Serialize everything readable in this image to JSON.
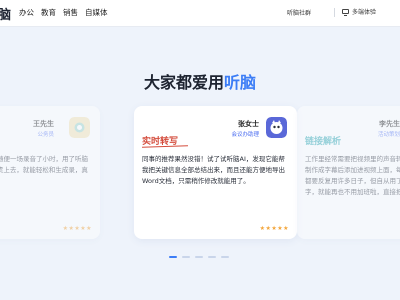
{
  "nav": {
    "logo": "脑",
    "menu": [
      "办公",
      "教育",
      "销售",
      "自媒体"
    ],
    "community": "听脑社群",
    "multi_label": "多端体验"
  },
  "heading": {
    "prefix": "大家都爱用",
    "accent": "听脑"
  },
  "cards": [
    {
      "name": "王先生",
      "title": "公务员",
      "tag": "转写",
      "quote": "作经常需要开会，随便一场录音了小时，用了听脑AI后，只需要把负责上去，就能轻松和生成录，真的帮了我的大忙！",
      "stars": "★★★★★",
      "avatar_color": "#f4e3b0"
    },
    {
      "name": "张女士",
      "title": "会议办助理",
      "tag": "实时转写",
      "quote": "同事的推荐果然没错！试了试听脑AI，发现它能帮我把关键信息全部总结出来，而且还能方便地导出Word文档，只需稍作修改就能用了。",
      "stars": "★★★★★",
      "avatar_color": "#5a68d8"
    },
    {
      "name": "李先生",
      "title": "活动策划",
      "tag": "链接解析",
      "quote": "工作里经常需要把视频里的声音转为文字，然后再制作成字幕后添加进视频上面，每次做字幕的时候都要反复用许多日子，但自从用了听脑的链接转文字，就能再也不用加班啦，直接把要做的",
      "stars": "★★★★★",
      "avatar_color": "#dde6f5"
    }
  ],
  "pager": {
    "count": 5,
    "active_index": 0
  },
  "colors": {
    "accent": "#3c7df6",
    "tag_red": "#d44c3c",
    "star": "#f3a53a",
    "background": "#eef3fb"
  }
}
